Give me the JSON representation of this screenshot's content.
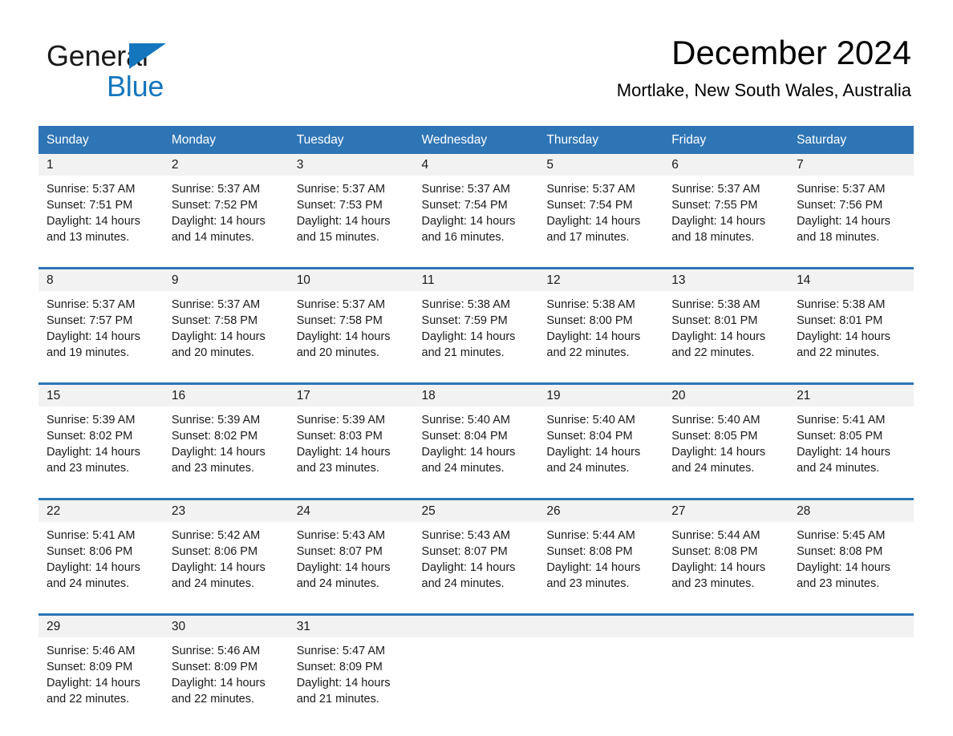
{
  "brand": {
    "line1": "General",
    "line2": "Blue",
    "triangle_color": "#1476bd",
    "text_color": "#1a1a1a"
  },
  "header": {
    "month_title": "December 2024",
    "location": "Mortlake, New South Wales, Australia"
  },
  "colors": {
    "header_band": "#2e75b6",
    "row_divider": "#2e75b6",
    "daynum_band": "#f2f2f2",
    "cell_background": "#ffffff",
    "text": "#1a1a1a"
  },
  "weekdays": [
    "Sunday",
    "Monday",
    "Tuesday",
    "Wednesday",
    "Thursday",
    "Friday",
    "Saturday"
  ],
  "weeks": [
    [
      {
        "day": "1",
        "sunrise": "Sunrise: 5:37 AM",
        "sunset": "Sunset: 7:51 PM",
        "daylight": "Daylight: 14 hours and 13 minutes."
      },
      {
        "day": "2",
        "sunrise": "Sunrise: 5:37 AM",
        "sunset": "Sunset: 7:52 PM",
        "daylight": "Daylight: 14 hours and 14 minutes."
      },
      {
        "day": "3",
        "sunrise": "Sunrise: 5:37 AM",
        "sunset": "Sunset: 7:53 PM",
        "daylight": "Daylight: 14 hours and 15 minutes."
      },
      {
        "day": "4",
        "sunrise": "Sunrise: 5:37 AM",
        "sunset": "Sunset: 7:54 PM",
        "daylight": "Daylight: 14 hours and 16 minutes."
      },
      {
        "day": "5",
        "sunrise": "Sunrise: 5:37 AM",
        "sunset": "Sunset: 7:54 PM",
        "daylight": "Daylight: 14 hours and 17 minutes."
      },
      {
        "day": "6",
        "sunrise": "Sunrise: 5:37 AM",
        "sunset": "Sunset: 7:55 PM",
        "daylight": "Daylight: 14 hours and 18 minutes."
      },
      {
        "day": "7",
        "sunrise": "Sunrise: 5:37 AM",
        "sunset": "Sunset: 7:56 PM",
        "daylight": "Daylight: 14 hours and 18 minutes."
      }
    ],
    [
      {
        "day": "8",
        "sunrise": "Sunrise: 5:37 AM",
        "sunset": "Sunset: 7:57 PM",
        "daylight": "Daylight: 14 hours and 19 minutes."
      },
      {
        "day": "9",
        "sunrise": "Sunrise: 5:37 AM",
        "sunset": "Sunset: 7:58 PM",
        "daylight": "Daylight: 14 hours and 20 minutes."
      },
      {
        "day": "10",
        "sunrise": "Sunrise: 5:37 AM",
        "sunset": "Sunset: 7:58 PM",
        "daylight": "Daylight: 14 hours and 20 minutes."
      },
      {
        "day": "11",
        "sunrise": "Sunrise: 5:38 AM",
        "sunset": "Sunset: 7:59 PM",
        "daylight": "Daylight: 14 hours and 21 minutes."
      },
      {
        "day": "12",
        "sunrise": "Sunrise: 5:38 AM",
        "sunset": "Sunset: 8:00 PM",
        "daylight": "Daylight: 14 hours and 22 minutes."
      },
      {
        "day": "13",
        "sunrise": "Sunrise: 5:38 AM",
        "sunset": "Sunset: 8:01 PM",
        "daylight": "Daylight: 14 hours and 22 minutes."
      },
      {
        "day": "14",
        "sunrise": "Sunrise: 5:38 AM",
        "sunset": "Sunset: 8:01 PM",
        "daylight": "Daylight: 14 hours and 22 minutes."
      }
    ],
    [
      {
        "day": "15",
        "sunrise": "Sunrise: 5:39 AM",
        "sunset": "Sunset: 8:02 PM",
        "daylight": "Daylight: 14 hours and 23 minutes."
      },
      {
        "day": "16",
        "sunrise": "Sunrise: 5:39 AM",
        "sunset": "Sunset: 8:02 PM",
        "daylight": "Daylight: 14 hours and 23 minutes."
      },
      {
        "day": "17",
        "sunrise": "Sunrise: 5:39 AM",
        "sunset": "Sunset: 8:03 PM",
        "daylight": "Daylight: 14 hours and 23 minutes."
      },
      {
        "day": "18",
        "sunrise": "Sunrise: 5:40 AM",
        "sunset": "Sunset: 8:04 PM",
        "daylight": "Daylight: 14 hours and 24 minutes."
      },
      {
        "day": "19",
        "sunrise": "Sunrise: 5:40 AM",
        "sunset": "Sunset: 8:04 PM",
        "daylight": "Daylight: 14 hours and 24 minutes."
      },
      {
        "day": "20",
        "sunrise": "Sunrise: 5:40 AM",
        "sunset": "Sunset: 8:05 PM",
        "daylight": "Daylight: 14 hours and 24 minutes."
      },
      {
        "day": "21",
        "sunrise": "Sunrise: 5:41 AM",
        "sunset": "Sunset: 8:05 PM",
        "daylight": "Daylight: 14 hours and 24 minutes."
      }
    ],
    [
      {
        "day": "22",
        "sunrise": "Sunrise: 5:41 AM",
        "sunset": "Sunset: 8:06 PM",
        "daylight": "Daylight: 14 hours and 24 minutes."
      },
      {
        "day": "23",
        "sunrise": "Sunrise: 5:42 AM",
        "sunset": "Sunset: 8:06 PM",
        "daylight": "Daylight: 14 hours and 24 minutes."
      },
      {
        "day": "24",
        "sunrise": "Sunrise: 5:43 AM",
        "sunset": "Sunset: 8:07 PM",
        "daylight": "Daylight: 14 hours and 24 minutes."
      },
      {
        "day": "25",
        "sunrise": "Sunrise: 5:43 AM",
        "sunset": "Sunset: 8:07 PM",
        "daylight": "Daylight: 14 hours and 24 minutes."
      },
      {
        "day": "26",
        "sunrise": "Sunrise: 5:44 AM",
        "sunset": "Sunset: 8:08 PM",
        "daylight": "Daylight: 14 hours and 23 minutes."
      },
      {
        "day": "27",
        "sunrise": "Sunrise: 5:44 AM",
        "sunset": "Sunset: 8:08 PM",
        "daylight": "Daylight: 14 hours and 23 minutes."
      },
      {
        "day": "28",
        "sunrise": "Sunrise: 5:45 AM",
        "sunset": "Sunset: 8:08 PM",
        "daylight": "Daylight: 14 hours and 23 minutes."
      }
    ],
    [
      {
        "day": "29",
        "sunrise": "Sunrise: 5:46 AM",
        "sunset": "Sunset: 8:09 PM",
        "daylight": "Daylight: 14 hours and 22 minutes."
      },
      {
        "day": "30",
        "sunrise": "Sunrise: 5:46 AM",
        "sunset": "Sunset: 8:09 PM",
        "daylight": "Daylight: 14 hours and 22 minutes."
      },
      {
        "day": "31",
        "sunrise": "Sunrise: 5:47 AM",
        "sunset": "Sunset: 8:09 PM",
        "daylight": "Daylight: 14 hours and 21 minutes."
      },
      {
        "day": "",
        "sunrise": "",
        "sunset": "",
        "daylight": ""
      },
      {
        "day": "",
        "sunrise": "",
        "sunset": "",
        "daylight": ""
      },
      {
        "day": "",
        "sunrise": "",
        "sunset": "",
        "daylight": ""
      },
      {
        "day": "",
        "sunrise": "",
        "sunset": "",
        "daylight": ""
      }
    ]
  ]
}
